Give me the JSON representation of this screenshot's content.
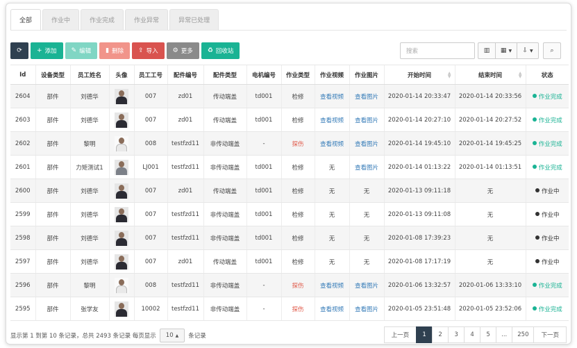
{
  "tabs": [
    {
      "label": "全部",
      "active": true
    },
    {
      "label": "作业中",
      "active": false
    },
    {
      "label": "作业完成",
      "active": false
    },
    {
      "label": "作业异常",
      "active": false
    },
    {
      "label": "异常已处理",
      "active": false
    }
  ],
  "toolbar": {
    "refresh_icon": "refresh-icon",
    "add": "添加",
    "edit": "编辑",
    "delete": "删除",
    "import": "导入",
    "more": "更多",
    "recycle": "回收站"
  },
  "search": {
    "placeholder": "搜索"
  },
  "columns": [
    "Id",
    "设备类型",
    "员工姓名",
    "头像",
    "员工工号",
    "配件编号",
    "配件类型",
    "电机编号",
    "作业类型",
    "作业视频",
    "作业图片",
    "开始时间",
    "结束时间",
    "状态"
  ],
  "rows": [
    {
      "id": "2604",
      "device": "部件",
      "name": "刘德华",
      "avatar": "dark",
      "emp": "007",
      "part": "zd01",
      "ptype": "传动端盖",
      "motor": "td001",
      "work": "检修",
      "work_warn": false,
      "video": "查看视频",
      "video_link": true,
      "image": "查看图片",
      "image_link": true,
      "start": "2020-01-14 20:33:47",
      "end": "2020-01-14 20:33:56",
      "status": "作业完成",
      "done": true
    },
    {
      "id": "2603",
      "device": "部件",
      "name": "刘德华",
      "avatar": "dark",
      "emp": "007",
      "part": "zd01",
      "ptype": "传动端盖",
      "motor": "td001",
      "work": "检修",
      "work_warn": false,
      "video": "查看视频",
      "video_link": true,
      "image": "查看图片",
      "image_link": true,
      "start": "2020-01-14 20:27:10",
      "end": "2020-01-14 20:27:52",
      "status": "作业完成",
      "done": true
    },
    {
      "id": "2602",
      "device": "部件",
      "name": "黎明",
      "avatar": "light",
      "emp": "008",
      "part": "testfzd11",
      "ptype": "非传动端盖",
      "motor": "-",
      "work": "探伤",
      "work_warn": true,
      "video": "查看视频",
      "video_link": true,
      "image": "查看图片",
      "image_link": true,
      "start": "2020-01-14 19:45:10",
      "end": "2020-01-14 19:45:25",
      "status": "作业完成",
      "done": true
    },
    {
      "id": "2601",
      "device": "部件",
      "name": "力矩测试1",
      "avatar": "grey",
      "emp": "LJ001",
      "part": "testfzd11",
      "ptype": "非传动端盖",
      "motor": "td001",
      "work": "检修",
      "work_warn": false,
      "video": "无",
      "video_link": false,
      "image": "查看图片",
      "image_link": true,
      "start": "2020-01-14 01:13:22",
      "end": "2020-01-14 01:13:51",
      "status": "作业完成",
      "done": true
    },
    {
      "id": "2600",
      "device": "部件",
      "name": "刘德华",
      "avatar": "dark",
      "emp": "007",
      "part": "zd01",
      "ptype": "传动端盖",
      "motor": "td001",
      "work": "检修",
      "work_warn": false,
      "video": "无",
      "video_link": false,
      "image": "无",
      "image_link": false,
      "start": "2020-01-13 09:11:18",
      "end": "无",
      "status": "作业中",
      "done": false
    },
    {
      "id": "2599",
      "device": "部件",
      "name": "刘德华",
      "avatar": "dark",
      "emp": "007",
      "part": "testfzd11",
      "ptype": "非传动端盖",
      "motor": "td001",
      "work": "检修",
      "work_warn": false,
      "video": "无",
      "video_link": false,
      "image": "无",
      "image_link": false,
      "start": "2020-01-13 09:11:08",
      "end": "无",
      "status": "作业中",
      "done": false
    },
    {
      "id": "2598",
      "device": "部件",
      "name": "刘德华",
      "avatar": "dark",
      "emp": "007",
      "part": "testfzd11",
      "ptype": "非传动端盖",
      "motor": "td001",
      "work": "检修",
      "work_warn": false,
      "video": "无",
      "video_link": false,
      "image": "无",
      "image_link": false,
      "start": "2020-01-08 17:39:23",
      "end": "无",
      "status": "作业中",
      "done": false
    },
    {
      "id": "2597",
      "device": "部件",
      "name": "刘德华",
      "avatar": "dark",
      "emp": "007",
      "part": "zd01",
      "ptype": "传动端盖",
      "motor": "td001",
      "work": "检修",
      "work_warn": false,
      "video": "无",
      "video_link": false,
      "image": "无",
      "image_link": false,
      "start": "2020-01-08 17:17:19",
      "end": "无",
      "status": "作业中",
      "done": false
    },
    {
      "id": "2596",
      "device": "部件",
      "name": "黎明",
      "avatar": "light",
      "emp": "008",
      "part": "testfzd11",
      "ptype": "非传动端盖",
      "motor": "-",
      "work": "探伤",
      "work_warn": true,
      "video": "查看视频",
      "video_link": true,
      "image": "查看图片",
      "image_link": true,
      "start": "2020-01-06 13:32:57",
      "end": "2020-01-06 13:33:10",
      "status": "作业完成",
      "done": true
    },
    {
      "id": "2595",
      "device": "部件",
      "name": "张学友",
      "avatar": "dark",
      "emp": "10002",
      "part": "testfzd11",
      "ptype": "非传动端盖",
      "motor": "-",
      "work": "探伤",
      "work_warn": true,
      "video": "查看视频",
      "video_link": true,
      "image": "查看图片",
      "image_link": true,
      "start": "2020-01-05 23:51:48",
      "end": "2020-01-05 23:52:06",
      "status": "作业完成",
      "done": true
    }
  ],
  "footer": {
    "summary": "显示第 1 到第 10 条记录，总共 2493 条记录 每页显示",
    "page_size": "10",
    "suffix": "条记录"
  },
  "pager": {
    "prev": "上一页",
    "pages": [
      "1",
      "2",
      "3",
      "4",
      "5",
      "...",
      "250"
    ],
    "active": "1",
    "next": "下一页"
  },
  "colors": {
    "dark": "#2f4050",
    "green": "#1ab394",
    "red": "#d9534f",
    "link": "#337ab7"
  }
}
